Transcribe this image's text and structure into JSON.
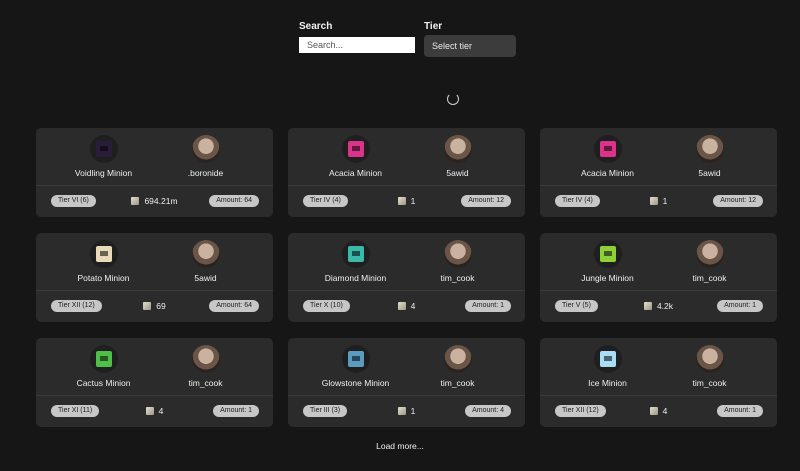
{
  "filters": {
    "search_label": "Search",
    "search_placeholder": "Search...",
    "tier_label": "Tier",
    "tier_select_value": "Select tier"
  },
  "cards": [
    {
      "minion": "Voidling Minion",
      "seller": ".boronide",
      "tier": "Tier VI (6)",
      "price": "694.21m",
      "amount": "Amount: 64",
      "color": "#2a1d3a"
    },
    {
      "minion": "Acacia Minion",
      "seller": "5awid",
      "tier": "Tier IV (4)",
      "price": "1",
      "amount": "Amount: 12",
      "color": "#d9338a"
    },
    {
      "minion": "Acacia Minion",
      "seller": "5awid",
      "tier": "Tier IV (4)",
      "price": "1",
      "amount": "Amount: 12",
      "color": "#d9338a"
    },
    {
      "minion": "Potato Minion",
      "seller": "5awid",
      "tier": "Tier XII (12)",
      "price": "69",
      "amount": "Amount: 64",
      "color": "#e8d9b8"
    },
    {
      "minion": "Diamond Minion",
      "seller": "tim_cook",
      "tier": "Tier X (10)",
      "price": "4",
      "amount": "Amount: 1",
      "color": "#3ab8a8"
    },
    {
      "minion": "Jungle Minion",
      "seller": "tim_cook",
      "tier": "Tier V (5)",
      "price": "4.2k",
      "amount": "Amount: 1",
      "color": "#8fd03a"
    },
    {
      "minion": "Cactus Minion",
      "seller": "tim_cook",
      "tier": "Tier XI (11)",
      "price": "4",
      "amount": "Amount: 1",
      "color": "#4fbf4a"
    },
    {
      "minion": "Glowstone Minion",
      "seller": "tim_cook",
      "tier": "Tier III (3)",
      "price": "1",
      "amount": "Amount: 4",
      "color": "#5a9cc0"
    },
    {
      "minion": "Ice Minion",
      "seller": "tim_cook",
      "tier": "Tier XII (12)",
      "price": "4",
      "amount": "Amount: 1",
      "color": "#a9dcf5"
    }
  ],
  "load_more_label": "Load more..."
}
